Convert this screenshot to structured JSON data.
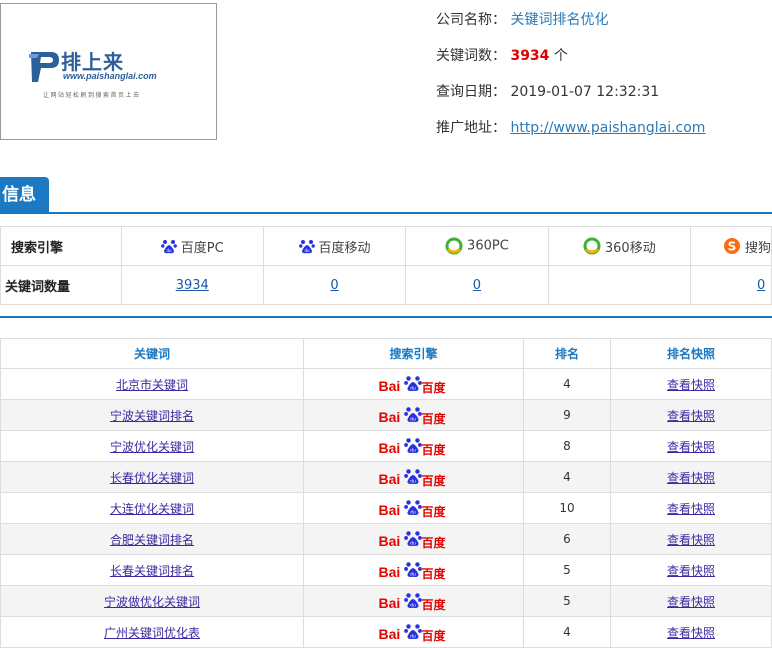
{
  "logo": {
    "name": "排上来",
    "url": "www.paishanglai.com",
    "slogan": "让网站轻松刷到搜索首页上去"
  },
  "company": {
    "name_label": "公司名称：",
    "name_value": "关键词排名优化",
    "keywords_label": "关键词数：",
    "keywords_value": "3934",
    "keywords_unit": "个",
    "date_label": "查询日期：",
    "date_value": "2019-01-07 12:32:31",
    "site_label": "推广地址：",
    "site_value": "http://www.paishanglai.com"
  },
  "section": {
    "title": "信息"
  },
  "engines": {
    "row_header": "搜索引擎",
    "count_header": "关键词数量",
    "items": [
      {
        "name": "百度PC",
        "icon": "baidu-paw-icon",
        "count": "3934"
      },
      {
        "name": "百度移动",
        "icon": "baidu-paw-icon",
        "count": "0"
      },
      {
        "name": "360PC",
        "icon": "360-icon",
        "count": "0"
      },
      {
        "name": "360移动",
        "icon": "360-icon",
        "count": ""
      },
      {
        "name": "搜狗",
        "icon": "sogou-icon",
        "count": "0"
      }
    ]
  },
  "keyword_table": {
    "headers": [
      "关键词",
      "搜索引擎",
      "排名",
      "排名快照"
    ],
    "engine_logo": {
      "left": "Bai",
      "right": "百度"
    },
    "rows": [
      {
        "keyword": "北京市关键词",
        "rank": "4",
        "snapshot": "查看快照"
      },
      {
        "keyword": "宁波关键词排名",
        "rank": "9",
        "snapshot": "查看快照"
      },
      {
        "keyword": "宁波优化关键词",
        "rank": "8",
        "snapshot": "查看快照"
      },
      {
        "keyword": "长春优化关键词",
        "rank": "4",
        "snapshot": "查看快照"
      },
      {
        "keyword": "大连优化关键词",
        "rank": "10",
        "snapshot": "查看快照"
      },
      {
        "keyword": "合肥关键词排名",
        "rank": "6",
        "snapshot": "查看快照"
      },
      {
        "keyword": "长春关键词排名",
        "rank": "5",
        "snapshot": "查看快照"
      },
      {
        "keyword": "宁波做优化关键词",
        "rank": "5",
        "snapshot": "查看快照"
      },
      {
        "keyword": "广州关键词优化表",
        "rank": "4",
        "snapshot": "查看快照"
      }
    ]
  },
  "colors": {
    "accent": "#1a79c2",
    "highlight": "#dd0000",
    "baidu_red": "#e10602",
    "baidu_blue": "#2932e1"
  }
}
